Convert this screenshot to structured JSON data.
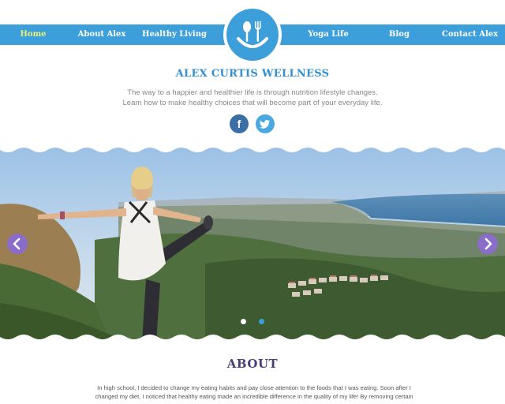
{
  "nav": {
    "items": [
      {
        "label": "Home",
        "active": true
      },
      {
        "label": "About Alex",
        "active": false
      },
      {
        "label": "Healthy Living",
        "active": false
      },
      {
        "label": "Yoga Life",
        "active": false
      },
      {
        "label": "Blog",
        "active": false
      },
      {
        "label": "Contact Alex",
        "active": false
      }
    ]
  },
  "logo": {
    "icon": "spoon-fork-smile-icon"
  },
  "header": {
    "title": "ALEX CURTIS WELLNESS",
    "tagline_line1": "The way to a happier and healthier life is through nutrition lifestyle changes.",
    "tagline_line2": "Learn how to make healthy choices that will become part of your everyday life."
  },
  "social": {
    "facebook_glyph": "f",
    "twitter_icon": "twitter-bird-icon"
  },
  "slider": {
    "current": 1,
    "total": 2,
    "prev_icon": "chevron-left-icon",
    "next_icon": "chevron-right-icon"
  },
  "about": {
    "title": "ABOUT",
    "line1": "In high school, I decided to change my eating habits and pay close attention to the foods that I was eating. Soon after I",
    "line2": "changed my diet, I noticed that healthy eating made an incredible difference in the quality of my life! By removing certain"
  },
  "colors": {
    "nav_bg": "#3d9fd9",
    "nav_active": "#e9f27a",
    "title_blue": "#2f8fd0",
    "about_purple": "#4a3e74",
    "arrow_purple": "#8a6cc9"
  }
}
